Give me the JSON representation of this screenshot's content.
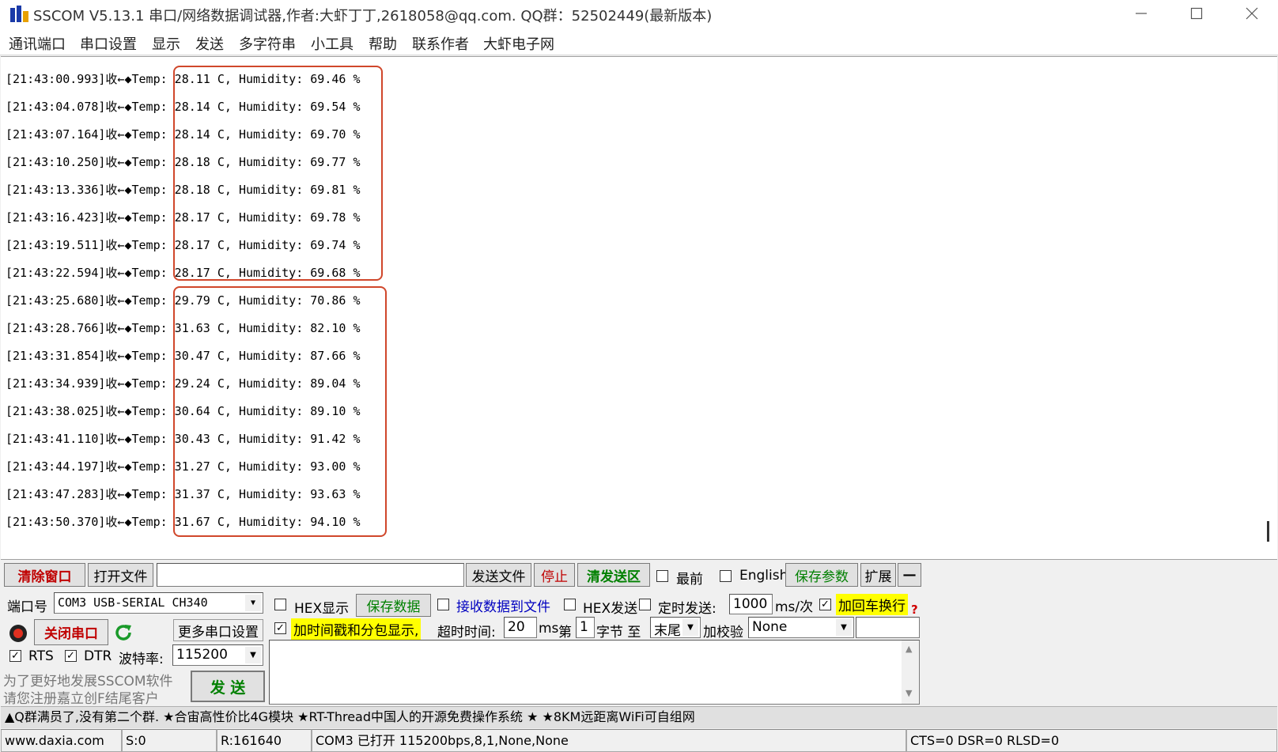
{
  "window": {
    "title": "SSCOM V5.13.1 串口/网络数据调试器,作者:大虾丁丁,2618058@qq.com. QQ群：52502449(最新版本)"
  },
  "menu": [
    "通讯端口",
    "串口设置",
    "显示",
    "发送",
    "多字符串",
    "小工具",
    "帮助",
    "联系作者",
    "大虾电子网"
  ],
  "receive_lines": [
    "[21:43:00.993]收←◆Temp: 28.11 C, Humidity: 69.46 %",
    "[21:43:04.078]收←◆Temp: 28.14 C, Humidity: 69.54 %",
    "[21:43:07.164]收←◆Temp: 28.14 C, Humidity: 69.70 %",
    "[21:43:10.250]收←◆Temp: 28.18 C, Humidity: 69.77 %",
    "[21:43:13.336]收←◆Temp: 28.18 C, Humidity: 69.81 %",
    "[21:43:16.423]收←◆Temp: 28.17 C, Humidity: 69.78 %",
    "[21:43:19.511]收←◆Temp: 28.17 C, Humidity: 69.74 %",
    "[21:43:22.594]收←◆Temp: 28.17 C, Humidity: 69.68 %",
    "[21:43:25.680]收←◆Temp: 29.79 C, Humidity: 70.86 %",
    "[21:43:28.766]收←◆Temp: 31.63 C, Humidity: 82.10 %",
    "[21:43:31.854]收←◆Temp: 30.47 C, Humidity: 87.66 %",
    "[21:43:34.939]收←◆Temp: 29.24 C, Humidity: 89.04 %",
    "[21:43:38.025]收←◆Temp: 30.64 C, Humidity: 89.10 %",
    "[21:43:41.110]收←◆Temp: 30.43 C, Humidity: 91.42 %",
    "[21:43:44.197]收←◆Temp: 31.27 C, Humidity: 93.00 %",
    "[21:43:47.283]收←◆Temp: 31.37 C, Humidity: 93.63 %",
    "[21:43:50.370]收←◆Temp: 31.67 C, Humidity: 94.10 %"
  ],
  "toolbar": {
    "clear_window": "清除窗口",
    "open_file": "打开文件",
    "file_path": "",
    "send_file": "发送文件",
    "stop": "停止",
    "clear_send": "清发送区",
    "topmost": "最前",
    "english": "English",
    "save_params": "保存参数",
    "expand": "扩展",
    "collapse": "—"
  },
  "port": {
    "port_label": "端口号",
    "port_value": "COM3 USB-SERIAL CH340",
    "close_port": "关闭串口",
    "more_settings": "更多串口设置",
    "rts": "RTS",
    "dtr": "DTR",
    "baud_label": "波特率:",
    "baud_value": "115200",
    "promo1": "为了更好地发展SSCOM软件",
    "promo2": "请您注册嘉立创F结尾客户",
    "send": "发 送"
  },
  "options": {
    "hex_display": "HEX显示",
    "save_data": "保存数据",
    "recv_to_file": "接收数据到文件",
    "hex_send": "HEX发送",
    "timed_send": "定时发送:",
    "interval": "1000",
    "interval_unit": "ms/次",
    "add_crlf": "加回车换行",
    "help_mark": "?",
    "timestamp": "加时间戳和分包显示,",
    "timeout_label": "超时时间:",
    "timeout": "20",
    "timeout_unit": "ms",
    "nth_label": "第",
    "nth": "1",
    "byte_label": "字节 至",
    "to_value": "末尾",
    "checksum_label": "加校验",
    "checksum_value": "None"
  },
  "ticker": "▲Q群满员了,没有第二个群. ★合宙高性价比4G模块 ★RT-Thread中国人的开源免费操作系统 ★ ★8KM远距离WiFi可自组网",
  "status": {
    "site": "www.daxia.com",
    "sent": "S:0",
    "received": "R:161640",
    "port_state": "COM3 已打开  115200bps,8,1,None,None",
    "lines": "CTS=0 DSR=0 RLSD=0"
  },
  "colors": {
    "highlight_box": "#d0472b",
    "red_button_text": "#c00000",
    "green_button_text": "#008000",
    "blue_link_text": "#0000c0"
  }
}
